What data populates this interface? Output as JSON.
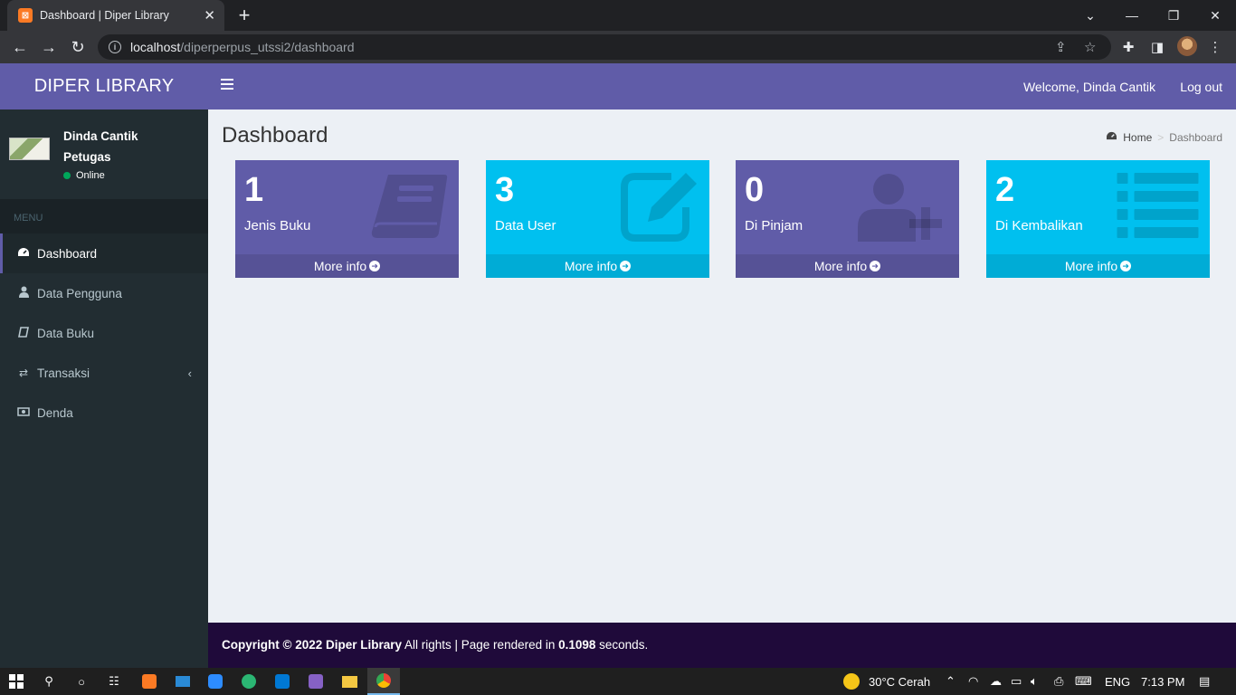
{
  "browser": {
    "tab_title": "Dashboard | Diper Library",
    "url_host": "localhost",
    "url_path": "/diperperpus_utssi2/dashboard"
  },
  "app": {
    "brand": "DIPER LIBRARY",
    "welcome": "Welcome, Dinda Cantik",
    "logout": "Log out"
  },
  "user": {
    "name": "Dinda Cantik",
    "role": "Petugas",
    "status": "Online"
  },
  "menu": {
    "header": "MENU",
    "items": [
      {
        "label": "Dashboard",
        "icon": "dashboard-icon"
      },
      {
        "label": "Data Pengguna",
        "icon": "user-icon"
      },
      {
        "label": "Data Buku",
        "icon": "book-icon"
      },
      {
        "label": "Transaksi",
        "icon": "exchange-icon"
      },
      {
        "label": "Denda",
        "icon": "money-icon"
      }
    ]
  },
  "content": {
    "title": "Dashboard",
    "breadcrumb": {
      "home": "Home",
      "current": "Dashboard"
    }
  },
  "boxes": [
    {
      "number": "1",
      "label": "Jenis Buku",
      "more": "More info",
      "color": "#605ca8",
      "icon": "book-icon"
    },
    {
      "number": "3",
      "label": "Data User",
      "more": "More info",
      "color": "#00c0ef",
      "icon": "edit-icon"
    },
    {
      "number": "0",
      "label": "Di Pinjam",
      "more": "More info",
      "color": "#605ca8",
      "icon": "user-plus-icon"
    },
    {
      "number": "2",
      "label": "Di Kembalikan",
      "more": "More info",
      "color": "#00c0ef",
      "icon": "list-icon"
    }
  ],
  "footer": {
    "copyright": "Copyright © 2022 Diper Library",
    "rights": " All rights | Page rendered in ",
    "time": "0.1098",
    "seconds": " seconds."
  },
  "taskbar": {
    "weather": "30°C  Cerah",
    "lang": "ENG",
    "time": "7:13 PM"
  }
}
